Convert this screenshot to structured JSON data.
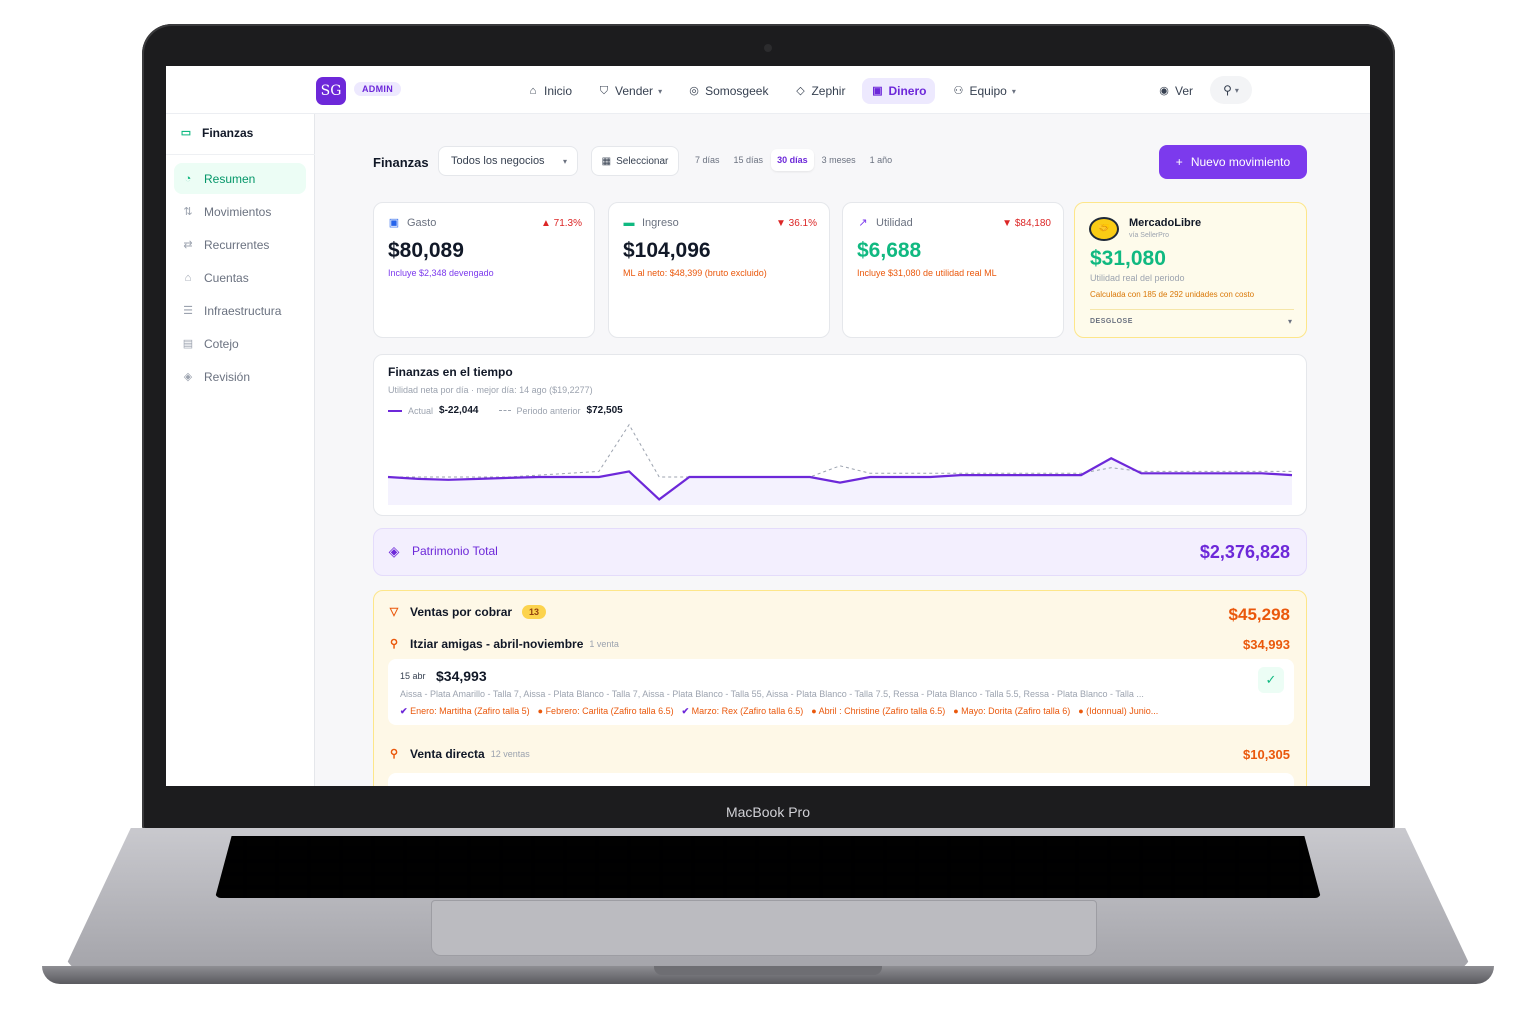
{
  "device": {
    "label": "MacBook Pro"
  },
  "app": {
    "logo": "SG",
    "role_badge": "ADMIN",
    "nav": [
      {
        "label": "Inicio",
        "icon": "home-icon"
      },
      {
        "label": "Vender",
        "icon": "cart-icon"
      },
      {
        "label": "Somosgeek",
        "icon": "spark-icon"
      },
      {
        "label": "Zephir",
        "icon": "gem-icon"
      },
      {
        "label": "Dinero",
        "icon": "money-icon"
      },
      {
        "label": "Equipo",
        "icon": "team-icon"
      }
    ],
    "ver_label": "Ver"
  },
  "sidebar": {
    "header": "Finanzas",
    "items": [
      {
        "label": "Resumen",
        "icon": "dashboard-icon"
      },
      {
        "label": "Movimientos",
        "icon": "arrows-icon"
      },
      {
        "label": "Recurrentes",
        "icon": "repeat-icon"
      },
      {
        "label": "Cuentas",
        "icon": "bank-icon"
      },
      {
        "label": "Infraestructura",
        "icon": "server-icon"
      },
      {
        "label": "Cotejo",
        "icon": "card-icon"
      },
      {
        "label": "Revisión",
        "icon": "shield-check-icon"
      }
    ]
  },
  "filters": {
    "title": "Finanzas",
    "business_select": "Todos los negocios",
    "date_button": "Seleccionar",
    "periods": [
      "7 días",
      "15 días",
      "30 días",
      "3 meses",
      "1 año"
    ],
    "active_period": "30 días",
    "new_button": "Nuevo movimiento"
  },
  "cards": {
    "gasto": {
      "label": "Gasto",
      "change": "▲ 71.3%",
      "value": "$80,089",
      "sub": "Incluye $2,348 devengado",
      "sub_color": "#7c3aed"
    },
    "ingreso": {
      "label": "Ingreso",
      "change": "▼ 36.1%",
      "value": "$104,096",
      "sub": "ML al neto: $48,399 (bruto excluido)",
      "sub_color": "#ea580c"
    },
    "utilidad": {
      "label": "Utilidad",
      "change": "▼ $84,180",
      "value": "$6,688",
      "sub": "Incluye $31,080 de utilidad real ML",
      "sub_color": "#ea580c"
    },
    "mercadolibre": {
      "name": "MercadoLibre",
      "via": "vía SellerPro",
      "value": "$31,080",
      "sub": "Utilidad real del periodo",
      "note": "Calculada con 185 de 292 unidades con costo",
      "breakdown": "DESGLOSE"
    }
  },
  "chart_data": {
    "type": "line",
    "title": "Finanzas en el tiempo",
    "subtitle": "Utilidad neta por día · mejor día: 14 ago ($19,2277)",
    "series": [
      {
        "name": "Actual",
        "total": "$-22,044",
        "color": "#6d28d9",
        "values": [
          0,
          -1,
          -1.5,
          -1,
          -0.5,
          0,
          0,
          0,
          3,
          -12,
          0,
          0,
          0,
          0,
          0,
          -3,
          0,
          0,
          0,
          1,
          1,
          1,
          1,
          1,
          10,
          2,
          2,
          2,
          2,
          2,
          1
        ]
      },
      {
        "name": "Periodo anterior",
        "total": "$72,505",
        "color": "#9ca3af",
        "dashed": true,
        "values": [
          0,
          0,
          0,
          0,
          0,
          1,
          2,
          3,
          28,
          0,
          0,
          0,
          0,
          0,
          0,
          6,
          2,
          2,
          2,
          2,
          2,
          2,
          2,
          2,
          5,
          3,
          3,
          3,
          3,
          3,
          3
        ]
      }
    ],
    "ylim": [
      -15,
      30
    ],
    "grid": false,
    "legend": "top-left"
  },
  "patrimonio": {
    "label": "Patrimonio Total",
    "value": "$2,376,828"
  },
  "ventas": {
    "label": "Ventas por cobrar",
    "count": "13",
    "total": "$45,298",
    "groups": [
      {
        "name": "Itziar amigas - abril-noviembre",
        "count": "1 venta",
        "total": "$34,993"
      },
      {
        "name": "Venta directa",
        "count": "12 ventas",
        "total": "$10,305"
      }
    ],
    "sale": {
      "date": "15 abr",
      "amount": "$34,993",
      "items": "Aissa - Plata Amarillo - Talla 7, Aissa - Plata Blanco - Talla 7, Aissa - Plata Blanco - Talla 55, Aissa - Plata Blanco - Talla 7.5, Ressa - Plata Blanco - Talla 5.5, Ressa - Plata Blanco - Talla ...",
      "notes": [
        {
          "text": "Enero: Martitha (Zafiro talla 5)",
          "icon": "✔"
        },
        {
          "text": "Febrero: Carlita (Zafiro talla 6.5)",
          "icon": "●"
        },
        {
          "text": "Marzo: Rex (Zafiro talla 6.5)",
          "icon": "✔"
        },
        {
          "text": "Abril : Christine (Zafiro talla 6.5)",
          "icon": "●"
        },
        {
          "text": "Mayo: Dorita (Zafiro talla 6)",
          "icon": "●"
        },
        {
          "text": "(Idonnual) Junio...",
          "icon": "●"
        }
      ]
    }
  }
}
